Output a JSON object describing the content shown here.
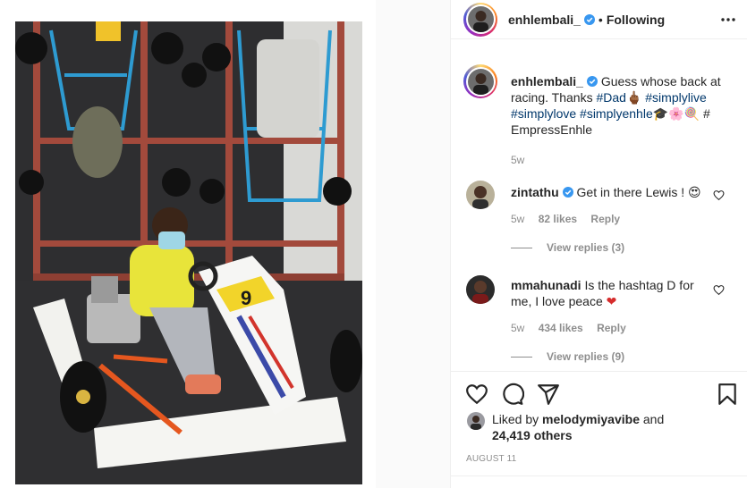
{
  "post": {
    "photo_alt": "Boy in yellow hoodie and face mask sitting in go-kart number 9",
    "kart_number": "9"
  },
  "header": {
    "username": "enhlembali_",
    "dot": "•",
    "follow_state": "Following",
    "more_icon": "more-horizontal-icon"
  },
  "caption": {
    "username": "enhlembali_",
    "text_plain": "Guess whose back at racing. Thanks ",
    "tags": [
      "#Dad",
      "#simplylive",
      "#simplylove",
      "#simplyenhle",
      "#"
    ],
    "tail": "EmpressEnhle",
    "emoji_after_dad": "🖕🏾",
    "emoji_after_enhle": "🎓🌸🍭",
    "time": "5w"
  },
  "comments": [
    {
      "username": "zintathu",
      "verified": true,
      "text": "Get in there Lewis ! 😍",
      "time": "5w",
      "likes": "82 likes",
      "reply": "Reply",
      "view_replies": "View replies (3)"
    },
    {
      "username": "mmahunadi",
      "verified": false,
      "text": "Is the hashtag D for me, I love peace",
      "heart": "❤",
      "time": "5w",
      "likes": "434 likes",
      "reply": "Reply",
      "view_replies": "View replies (9)"
    }
  ],
  "actions": {
    "icons": [
      "heart-icon",
      "comment-icon",
      "share-icon",
      "bookmark-icon"
    ]
  },
  "likes": {
    "prefix": "Liked by ",
    "user": "melodymiyavibe",
    "suffix": " and",
    "count_line": "24,419 others"
  },
  "date": "AUGUST 11",
  "colors": {
    "verified_blue": "#3897f0",
    "link_blue": "#00376b",
    "meta_gray": "#8e8e8e",
    "text": "#262626",
    "heart_red": "#ed4956"
  }
}
